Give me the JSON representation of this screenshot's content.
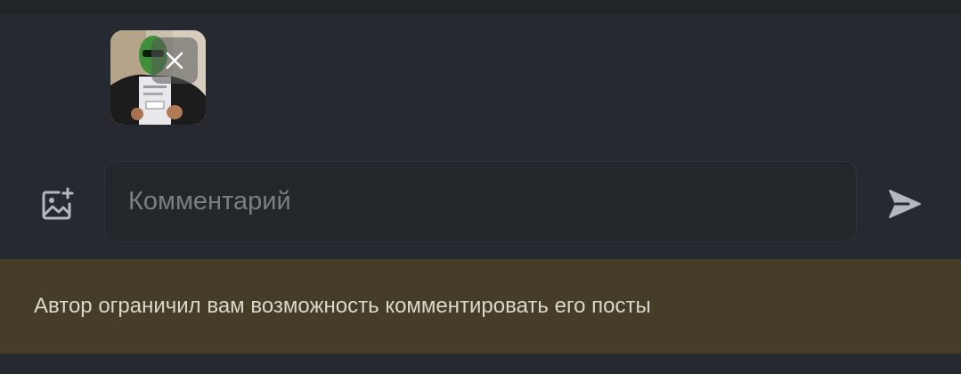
{
  "composer": {
    "comment_placeholder": "Комментарий",
    "add_image_icon": "image-plus-icon",
    "send_icon": "send-arrow-icon",
    "remove_attachment_icon": "close-icon"
  },
  "attachment": {
    "kind": "photo-thumbnail",
    "subject": "person in green balaclava holding paper"
  },
  "notice": {
    "text": "Автор ограничил вам возможность комментировать его посты"
  },
  "colors": {
    "background": "#262a30",
    "input_background": "#23272c",
    "notice_background": "#453d28",
    "notice_text": "#dcd7cb",
    "icon": "#b4b8be",
    "placeholder": "#7a7e83"
  }
}
